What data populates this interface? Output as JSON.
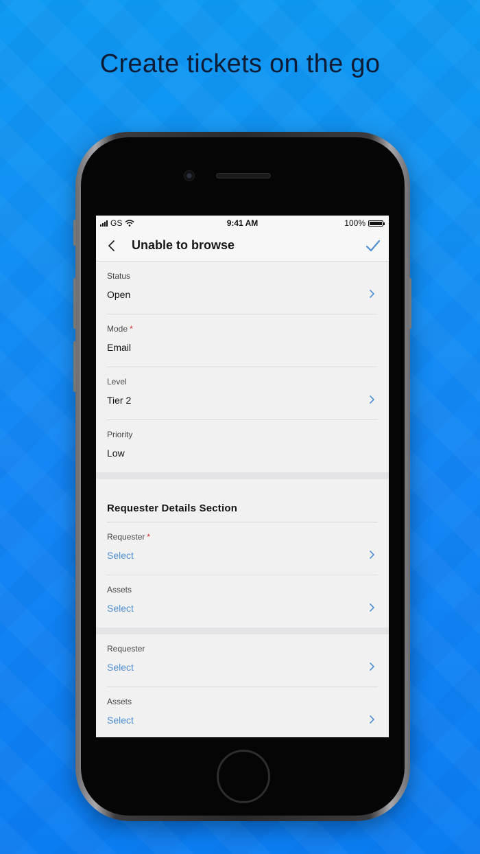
{
  "headline": "Create tickets on the go",
  "status_bar": {
    "carrier": "GS",
    "time": "9:41 AM",
    "battery": "100%"
  },
  "nav": {
    "title": "Unable to browse",
    "back_icon": "chevron-left-icon",
    "done_icon": "checkmark-icon"
  },
  "fields": [
    {
      "label": "Status",
      "value": "Open",
      "required": false,
      "chevron": true
    },
    {
      "label": "Mode",
      "value": "Email",
      "required": true,
      "chevron": false
    },
    {
      "label": "Level",
      "value": "Tier 2",
      "required": false,
      "chevron": true
    },
    {
      "label": "Priority",
      "value": "Low",
      "required": false,
      "chevron": false
    }
  ],
  "requester_section": {
    "title": "Requester Details Section",
    "fields": [
      {
        "label": "Requester",
        "value": "Select",
        "required": true
      },
      {
        "label": "Assets",
        "value": "Select",
        "required": false
      }
    ]
  },
  "extra_fields": [
    {
      "label": "Requester",
      "value": "Select"
    },
    {
      "label": "Assets",
      "value": "Select"
    }
  ],
  "required_marker": "*",
  "colors": {
    "accent": "#4f8fd1",
    "required": "#d12c2c",
    "background": "#1486f5"
  }
}
